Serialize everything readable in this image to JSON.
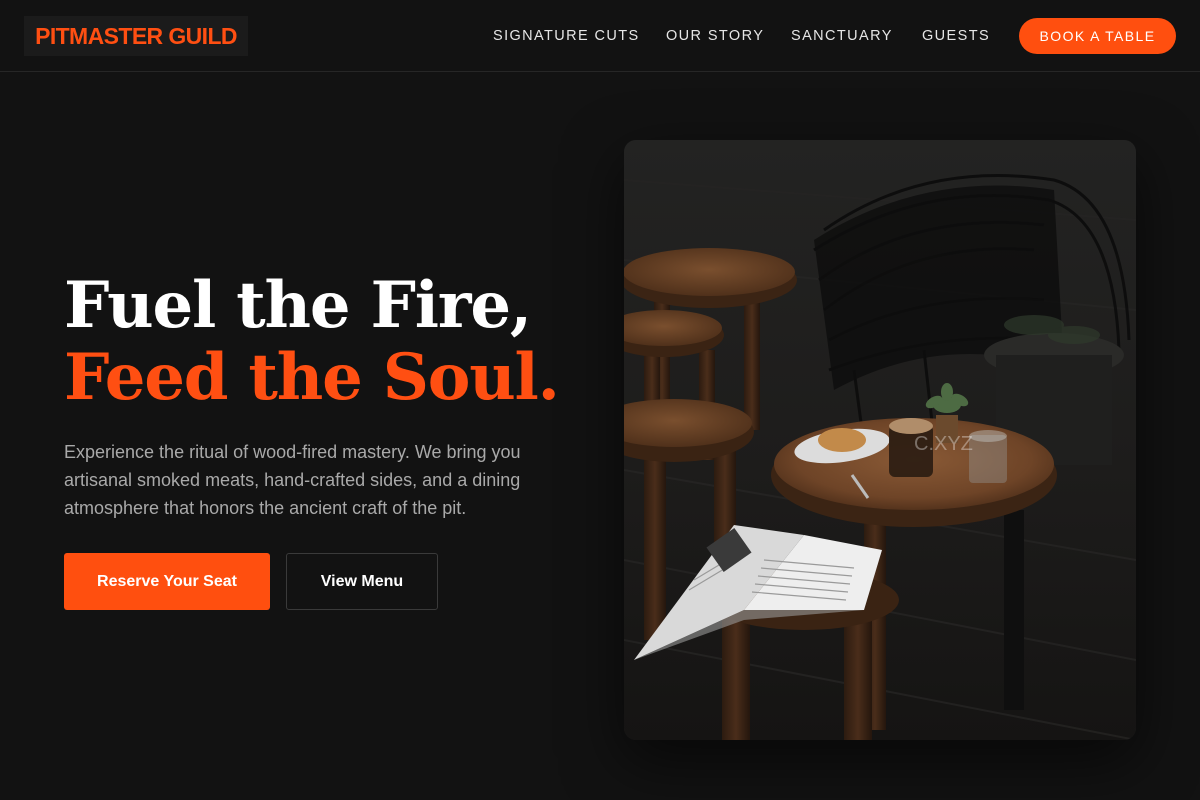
{
  "brand": {
    "name": "PITMASTER GUILD",
    "accent_color": "#ff4f0f"
  },
  "nav": {
    "links": [
      {
        "label": "SIGNATURE CUTS"
      },
      {
        "label": "OUR STORY"
      },
      {
        "label": "SANCTUARY"
      },
      {
        "label": "GUESTS"
      }
    ],
    "cta_label": "BOOK A TABLE"
  },
  "hero": {
    "headline_line1": "Fuel the Fire,",
    "headline_line2": "Feed the Soul.",
    "description": "Experience the ritual of wood-fired mastery. We bring you artisanal smoked meats, hand-crafted sides, and a dining atmosphere that honors the ancient craft of the pit.",
    "primary_button": "Reserve Your Seat",
    "secondary_button": "View Menu",
    "image": {
      "subject": "cafe-table-photo",
      "watermark": "C.XYZ"
    }
  }
}
